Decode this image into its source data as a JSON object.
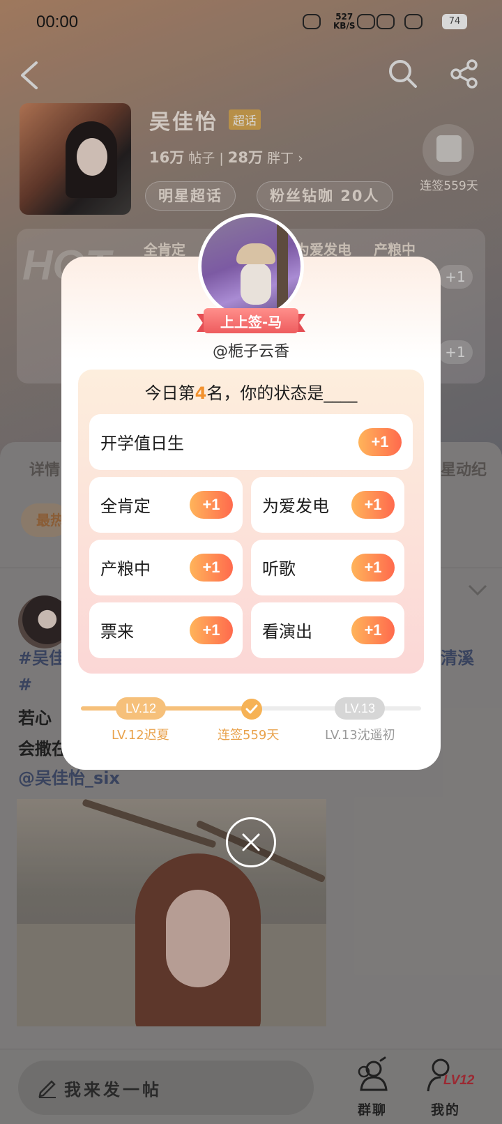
{
  "status_bar": {
    "time": "00:00",
    "net_speed": "527",
    "net_unit": "KB/S",
    "battery": "74"
  },
  "header": {
    "star_name": "吴佳怡",
    "super_tag": "超话",
    "posts_count": "16万",
    "posts_label": "帖子",
    "fans_count": "28万",
    "fans_label": "胖丁",
    "chip_star": "明星超话",
    "chip_fans": "粉丝钻咖 20人",
    "checkin_text": "连签559天"
  },
  "hot_board": {
    "word": "HOT",
    "cells": [
      "全肯定",
      "为爱发电",
      "产粮中"
    ],
    "plus": "+1"
  },
  "content": {
    "tab_left": "详情",
    "tab_right": "星动纪",
    "sort_label": "最热",
    "post_tag_left": "#吴佳",
    "post_tag_right": "清溪",
    "post_hash": "#",
    "post_line1": "若心",
    "post_line2": "会撒在",
    "post_mention": "@吴佳怡_six"
  },
  "bottom_bar": {
    "compose_label": "我来发一帖",
    "group_label": "群聊",
    "me_label": "我的",
    "me_level": "LV12"
  },
  "modal": {
    "banner": "上上签-马",
    "username": "@栀子云香",
    "question_prefix": "今日第",
    "rank": "4",
    "question_suffix": "名，你的状态是____",
    "plus": "+1",
    "options": [
      "开学值日生",
      "全肯定",
      "为爱发电",
      "产粮中",
      "听歌",
      "票来",
      "看演出"
    ],
    "level_current": "LV.12",
    "level_next": "LV.13",
    "level_progress": 0.5,
    "caption_current": "LV.12迟夏",
    "caption_streak": "连签559天",
    "caption_next": "LV.13沈遥初"
  },
  "colors": {
    "accent_orange": "#f2922f",
    "plus_gradient_start": "#ffb45a",
    "plus_gradient_end": "#ff6a4d",
    "banner_red": "#ee5c5e",
    "level_gold": "#f6c07a"
  }
}
